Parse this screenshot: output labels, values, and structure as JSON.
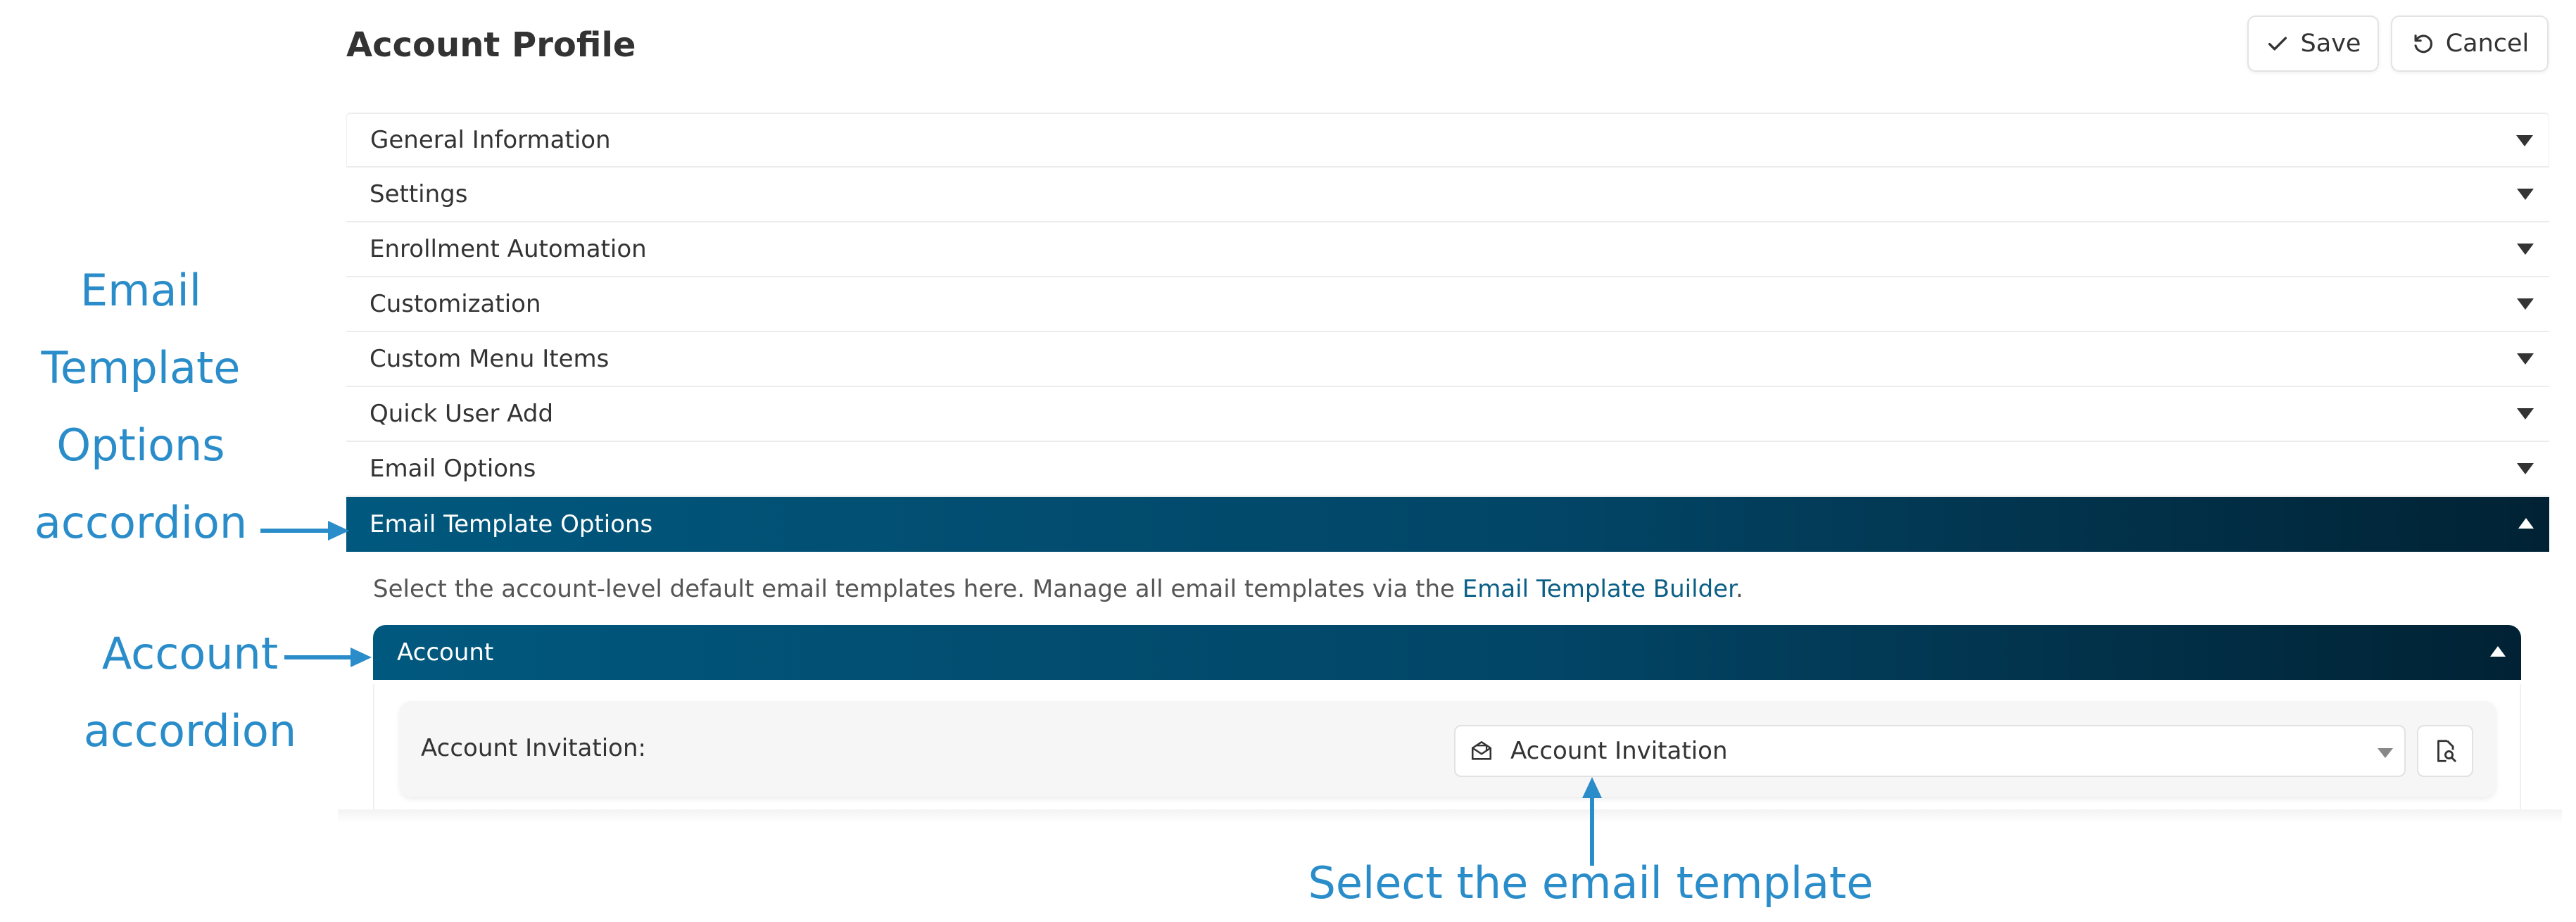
{
  "header": {
    "title": "Account Profile",
    "save_label": "Save",
    "cancel_label": "Cancel"
  },
  "accordions": [
    {
      "label": "General Information"
    },
    {
      "label": "Settings"
    },
    {
      "label": "Enrollment Automation"
    },
    {
      "label": "Customization"
    },
    {
      "label": "Custom Menu Items"
    },
    {
      "label": "Quick User Add"
    },
    {
      "label": "Email Options"
    }
  ],
  "active_accordion": {
    "label": "Email Template Options",
    "description_prefix": "Select the account-level default email templates here. Manage all email templates via the ",
    "description_link": "Email Template Builder",
    "description_suffix": "."
  },
  "sub_accordion": {
    "label": "Account",
    "field_label": "Account Invitation:",
    "selected_template": "Account Invitation"
  },
  "annotations": {
    "email_template": [
      "Email",
      "Template",
      "Options",
      "accordion"
    ],
    "account": [
      "Account",
      "accordion"
    ],
    "select": "Select the email template"
  },
  "colors": {
    "accent": "#01587e",
    "accent_dark": "#012234",
    "annotation": "#2a8dca",
    "link": "#0b5e86"
  }
}
